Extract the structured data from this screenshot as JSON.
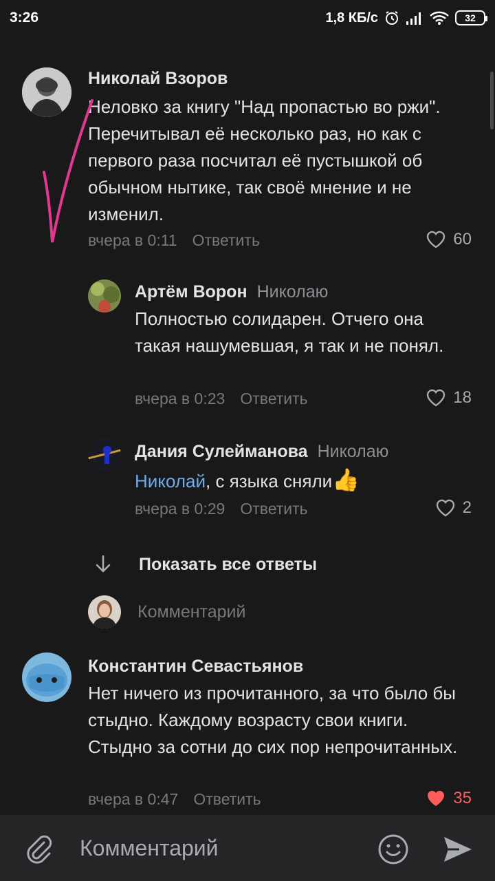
{
  "status_bar": {
    "time": "3:26",
    "network_speed": "1,8 КБ/с",
    "battery": "32",
    "icons": [
      "alarm-icon",
      "signal-icon",
      "wifi-icon",
      "battery-icon"
    ]
  },
  "comments": [
    {
      "author": "Николай Взоров",
      "text": "Неловко за книгу \"Над пропастью во ржи\". Перечитывал её несколько раз, но как с первого раза посчитал её пустышкой об обычном нытике, так своё мнение и не изменил.",
      "time": "вчера в 0:11",
      "reply_label": "Ответить",
      "likes": "60"
    },
    {
      "author": "Артём Ворон",
      "reply_to": "Николаю",
      "text": "Полностью солидарен. Отчего она такая нашумевшая, я так и не понял.",
      "time": "вчера в 0:23",
      "reply_label": "Ответить",
      "likes": "18"
    },
    {
      "author": "Дания Сулейманова",
      "reply_to": "Николаю",
      "mention": "Николай",
      "text": ", с языка сняли",
      "emoji": "👍",
      "time": "вчера в 0:29",
      "reply_label": "Ответить",
      "likes": "2"
    },
    {
      "author": "Константин Севастьянов",
      "text": "Нет ничего из прочитанного, за что было бы стыдно. Каждому возрасту свои книги. Стыдно за сотни до сих пор непрочитанных.",
      "time": "вчера в 0:47",
      "reply_label": "Ответить",
      "likes": "35"
    }
  ],
  "thread": {
    "show_all_label": "Показать все ответы",
    "reply_placeholder": "Комментарий"
  },
  "composer": {
    "placeholder": "Комментарий"
  },
  "colors": {
    "background": "#19191a",
    "text": "#e1e3e6",
    "secondary": "#76787a",
    "mention": "#71aaeb",
    "liked": "#ff5c5c",
    "accent": "#e040a0"
  }
}
